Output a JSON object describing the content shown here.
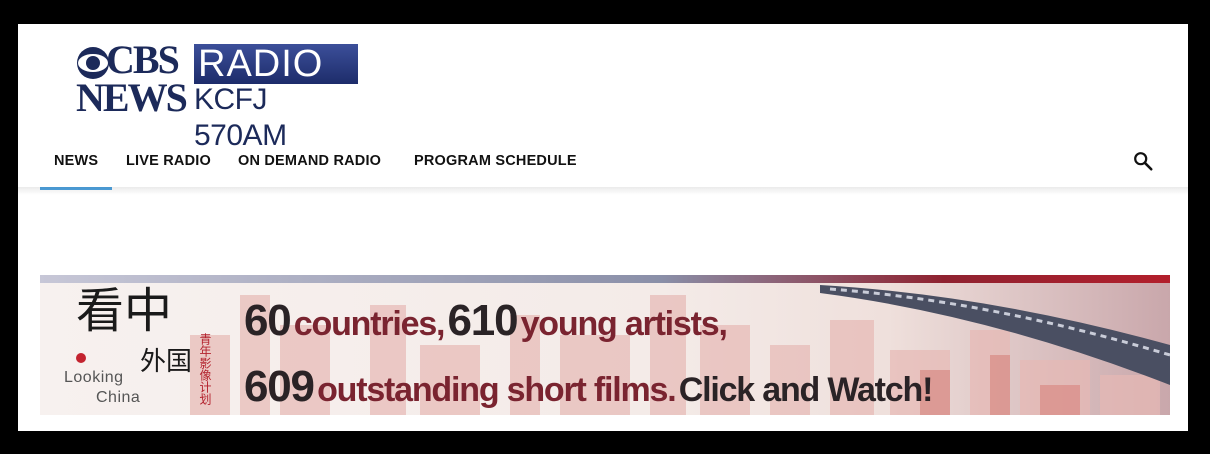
{
  "logo": {
    "line1": "CBS",
    "line2": "NEWS",
    "radio": "RADIO",
    "station": "KCFJ 570AM"
  },
  "nav": {
    "items": [
      {
        "label": "NEWS",
        "active": true
      },
      {
        "label": "LIVE RADIO",
        "active": false
      },
      {
        "label": "ON DEMAND RADIO",
        "active": false
      },
      {
        "label": "PROGRAM SCHEDULE",
        "active": false
      }
    ],
    "search_icon": "search-icon"
  },
  "banner": {
    "logo_cn_1": "看中",
    "logo_cn_2": "外国",
    "logo_small_cn": "青年影像计划",
    "logo_en_1": "Looking",
    "logo_en_2": "China",
    "line1": {
      "n1": "60",
      "t1": "countries,",
      "n2": "610",
      "t2": "young artists,"
    },
    "line2": {
      "n1": "609",
      "t1": "outstanding short films.",
      "t2": "Click and Watch!"
    }
  },
  "colors": {
    "nav_active_underline": "#4fa3e0",
    "brand_navy": "#1c2a5a",
    "banner_red": "#7a2430"
  }
}
